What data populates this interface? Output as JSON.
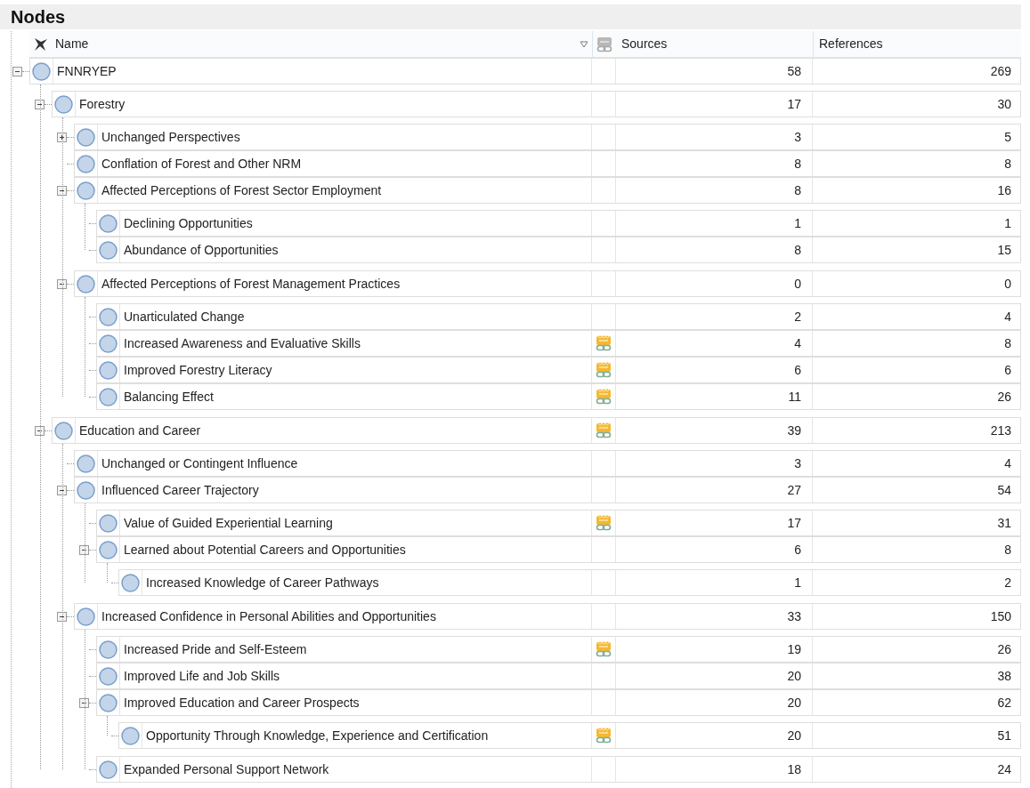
{
  "title": "Nodes",
  "columns": [
    {
      "label": "Name"
    },
    {
      "label": "Sources"
    },
    {
      "label": "References"
    }
  ],
  "nodes": [
    {
      "name": "FNNRYEP",
      "sources": "58",
      "references": "269",
      "memo": false,
      "expanded": true,
      "children": [
        {
          "name": "Forestry",
          "sources": "17",
          "references": "30",
          "memo": false,
          "expanded": true,
          "children": [
            {
              "name": "Unchanged Perspectives",
              "sources": "3",
              "references": "5",
              "memo": false,
              "expanded": false
            },
            {
              "name": "Conflation of Forest and Other NRM",
              "sources": "8",
              "references": "8",
              "memo": false
            },
            {
              "name": "Affected Perceptions of Forest Sector Employment",
              "sources": "8",
              "references": "16",
              "memo": false,
              "expanded": true,
              "children": [
                {
                  "name": "Declining Opportunities",
                  "sources": "1",
                  "references": "1",
                  "memo": false
                },
                {
                  "name": "Abundance of Opportunities",
                  "sources": "8",
                  "references": "15",
                  "memo": false
                }
              ]
            },
            {
              "name": "Affected Perceptions of Forest Management Practices",
              "sources": "0",
              "references": "0",
              "memo": false,
              "expanded": true,
              "children": [
                {
                  "name": "Unarticulated Change",
                  "sources": "2",
                  "references": "4",
                  "memo": false
                },
                {
                  "name": "Increased Awareness and Evaluative Skills",
                  "sources": "4",
                  "references": "8",
                  "memo": true
                },
                {
                  "name": "Improved Forestry Literacy",
                  "sources": "6",
                  "references": "6",
                  "memo": true
                },
                {
                  "name": "Balancing Effect",
                  "sources": "11",
                  "references": "26",
                  "memo": true
                }
              ]
            }
          ]
        },
        {
          "name": "Education and Career",
          "sources": "39",
          "references": "213",
          "memo": true,
          "expanded": true,
          "children": [
            {
              "name": "Unchanged or Contingent Influence",
              "sources": "3",
              "references": "4",
              "memo": false
            },
            {
              "name": "Influenced Career Trajectory",
              "sources": "27",
              "references": "54",
              "memo": false,
              "expanded": true,
              "children": [
                {
                  "name": "Value of Guided Experiential Learning",
                  "sources": "17",
                  "references": "31",
                  "memo": true
                },
                {
                  "name": "Learned about Potential Careers and Opportunities",
                  "sources": "6",
                  "references": "8",
                  "memo": false,
                  "expanded": true,
                  "children": [
                    {
                      "name": "Increased Knowledge of Career Pathways",
                      "sources": "1",
                      "references": "2",
                      "memo": false
                    }
                  ]
                }
              ]
            },
            {
              "name": "Increased Confidence in Personal Abilities and Opportunities",
              "sources": "33",
              "references": "150",
              "memo": false,
              "expanded": true,
              "children": [
                {
                  "name": "Increased Pride and Self-Esteem",
                  "sources": "19",
                  "references": "26",
                  "memo": true
                },
                {
                  "name": "Improved Life and Job Skills",
                  "sources": "20",
                  "references": "38",
                  "memo": false
                },
                {
                  "name": "Improved Education and Career Prospects",
                  "sources": "20",
                  "references": "62",
                  "memo": false,
                  "expanded": true,
                  "children": [
                    {
                      "name": "Opportunity Through Knowledge, Experience and Certification",
                      "sources": "20",
                      "references": "51",
                      "memo": true
                    }
                  ]
                },
                {
                  "name": "Expanded Personal Support Network",
                  "sources": "18",
                  "references": "24",
                  "memo": false
                }
              ]
            }
          ]
        }
      ]
    }
  ]
}
